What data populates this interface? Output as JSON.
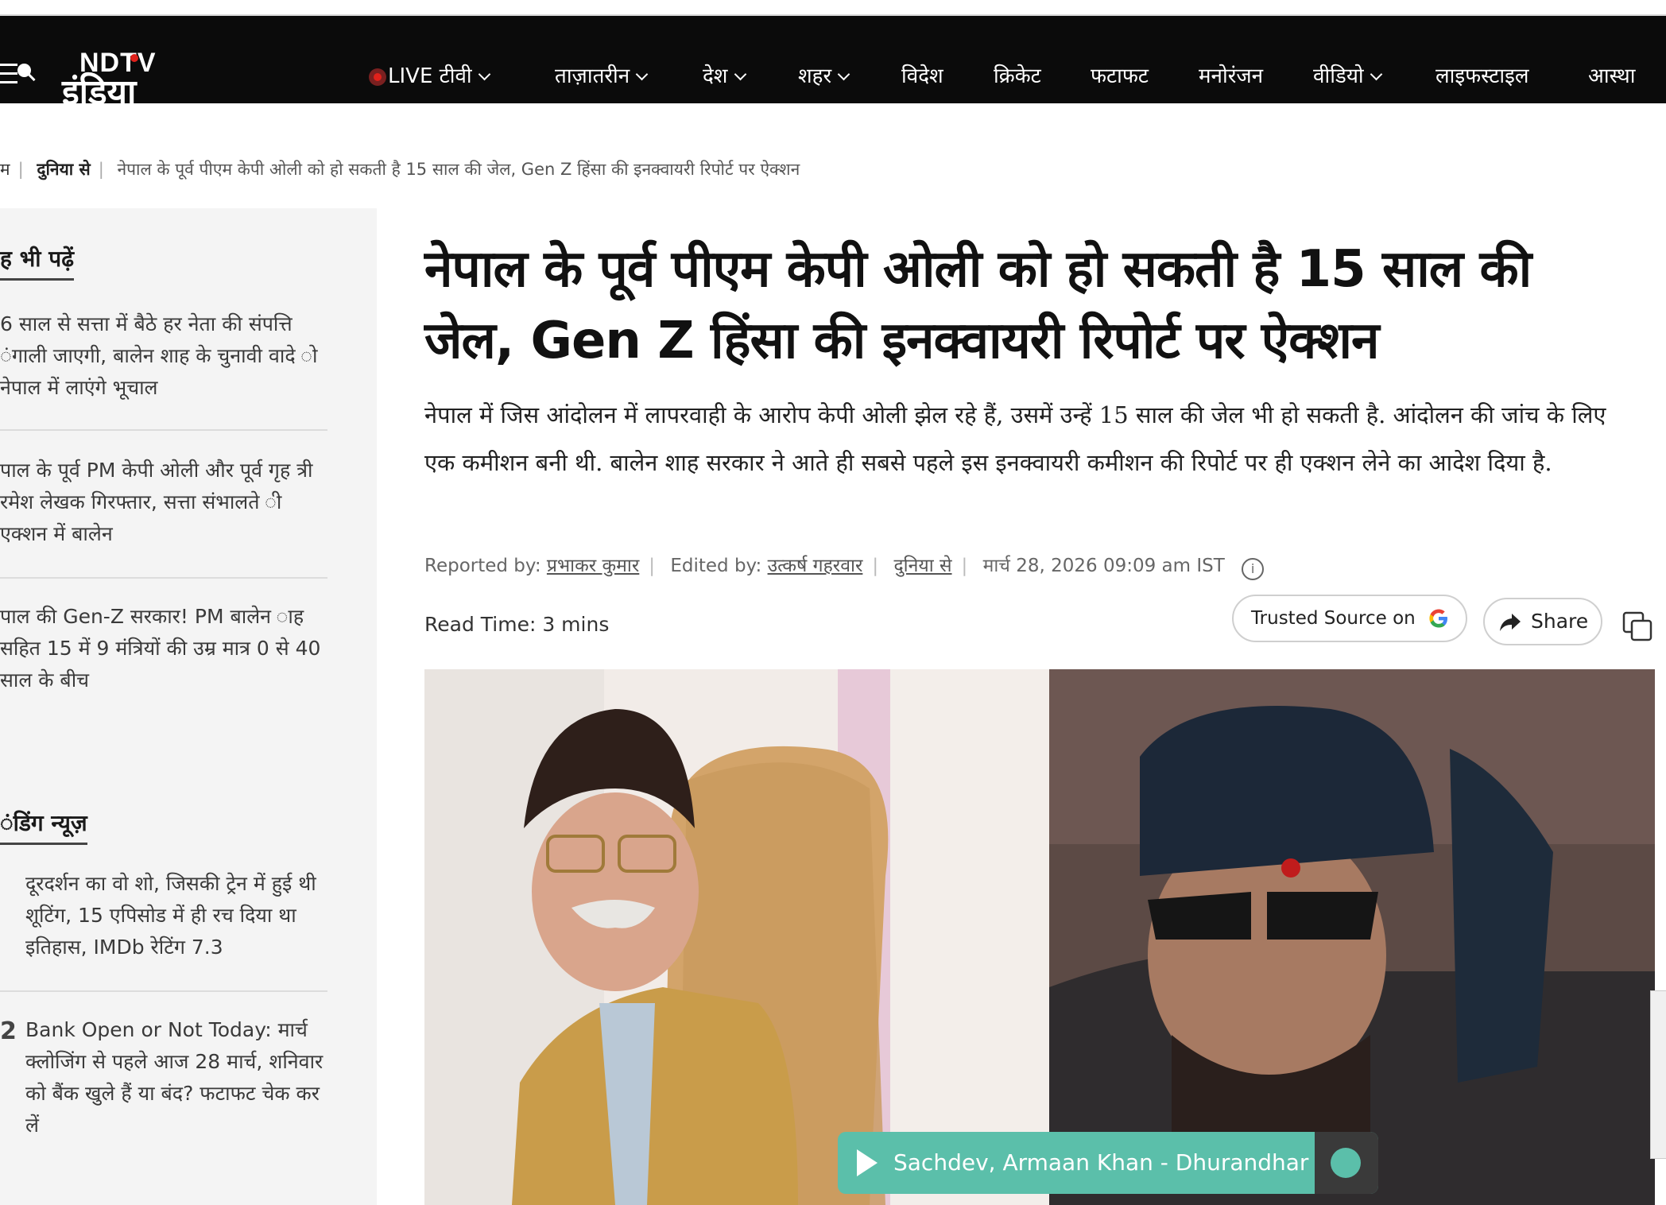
{
  "header": {
    "logo_top": "NDTV",
    "logo_bottom": "इंडिया",
    "nav": [
      {
        "label": "LIVE टीवी",
        "dropdown": true,
        "live": true
      },
      {
        "label": "ताज़ातरीन",
        "dropdown": true
      },
      {
        "label": "देश",
        "dropdown": true
      },
      {
        "label": "शहर",
        "dropdown": true
      },
      {
        "label": "विदेश",
        "dropdown": false
      },
      {
        "label": "क्रिकेट",
        "dropdown": false
      },
      {
        "label": "फटाफट",
        "dropdown": false
      },
      {
        "label": "मनोरंजन",
        "dropdown": false
      },
      {
        "label": "वीडियो",
        "dropdown": true
      },
      {
        "label": "लाइफस्टाइल",
        "dropdown": false
      },
      {
        "label": "आस्था",
        "dropdown": false
      }
    ]
  },
  "breadcrumb": {
    "home": "म",
    "section": "दुनिया से",
    "current": "नेपाल के पूर्व पीएम केपी ओली को हो सकती है 15 साल की जेल, Gen Z हिंसा की इनक्वायरी रिपोर्ट पर ऐक्शन"
  },
  "sidebar": {
    "also_read_heading": "ह भी पढ़ें",
    "also_read": [
      "6 साल से सत्ता में बैठे हर नेता की संपत्ति ंगाली जाएगी, बालेन शाह के चुनावी वादे ो नेपाल में लाएंगे भूचाल",
      "पाल के पूर्व PM केपी ओली और पूर्व गृह त्री रमेश लेखक गिरफ्तार, सत्ता संभालते ी एक्शन में बालेन",
      "पाल की Gen-Z सरकार! PM बालेन ाह सहित 15 में 9 मंत्रियों की उम्र मात्र 0 से 40 साल के बीच"
    ],
    "trending_heading": "ंडिंग न्यूज़",
    "trending": [
      {
        "num": "",
        "text": "दूरदर्शन का वो शो, जिसकी ट्रेन में हुई थी शूटिंग, 15 एपिसोड में ही रच दिया था इतिहास, IMDb रेटिंग 7.3"
      },
      {
        "num": "2",
        "text": "Bank Open or Not Today: मार्च क्लोजिंग से पहले आज 28 मार्च, शनिवार को बैंक खुले हैं या बंद? फटाफट चेक कर लें"
      }
    ]
  },
  "article": {
    "headline": "नेपाल के पूर्व पीएम केपी ओली को हो सकती है 15 साल की जेल, Gen Z हिंसा की इनक्वायरी रिपोर्ट पर ऐक्शन",
    "summary": "नेपाल में जिस आंदोलन में लापरवाही के आरोप केपी ओली झेल रहे हैं, उसमें उन्हें 15 साल की जेल भी हो सकती है. आंदोलन की जांच के लिए एक कमीशन बनी थी. बालेन शाह सरकार ने आते ही सबसे पहले इस इनक्वायरी कमीशन की रिपोर्ट पर ही एक्शन लेने का आदेश दिया है.",
    "reported_label": "Reported by:",
    "reported_by": "प्रभाकर कुमार",
    "edited_label": "Edited by:",
    "edited_by": "उत्कर्ष गहरवार",
    "section": "दुनिया से",
    "datetime": "मार्च 28, 2026 09:09 am IST",
    "read_time_label": "Read Time:",
    "read_time": "3 mins",
    "trusted_label": "Trusted Source on",
    "share_label": "Share"
  },
  "player": {
    "title": "Sachdev, Armaan Khan - Dhurandhar"
  },
  "colors": {
    "nav_bg": "#0b0b0b",
    "live_red": "#e0211b",
    "player_teal": "#5bbfaa"
  }
}
